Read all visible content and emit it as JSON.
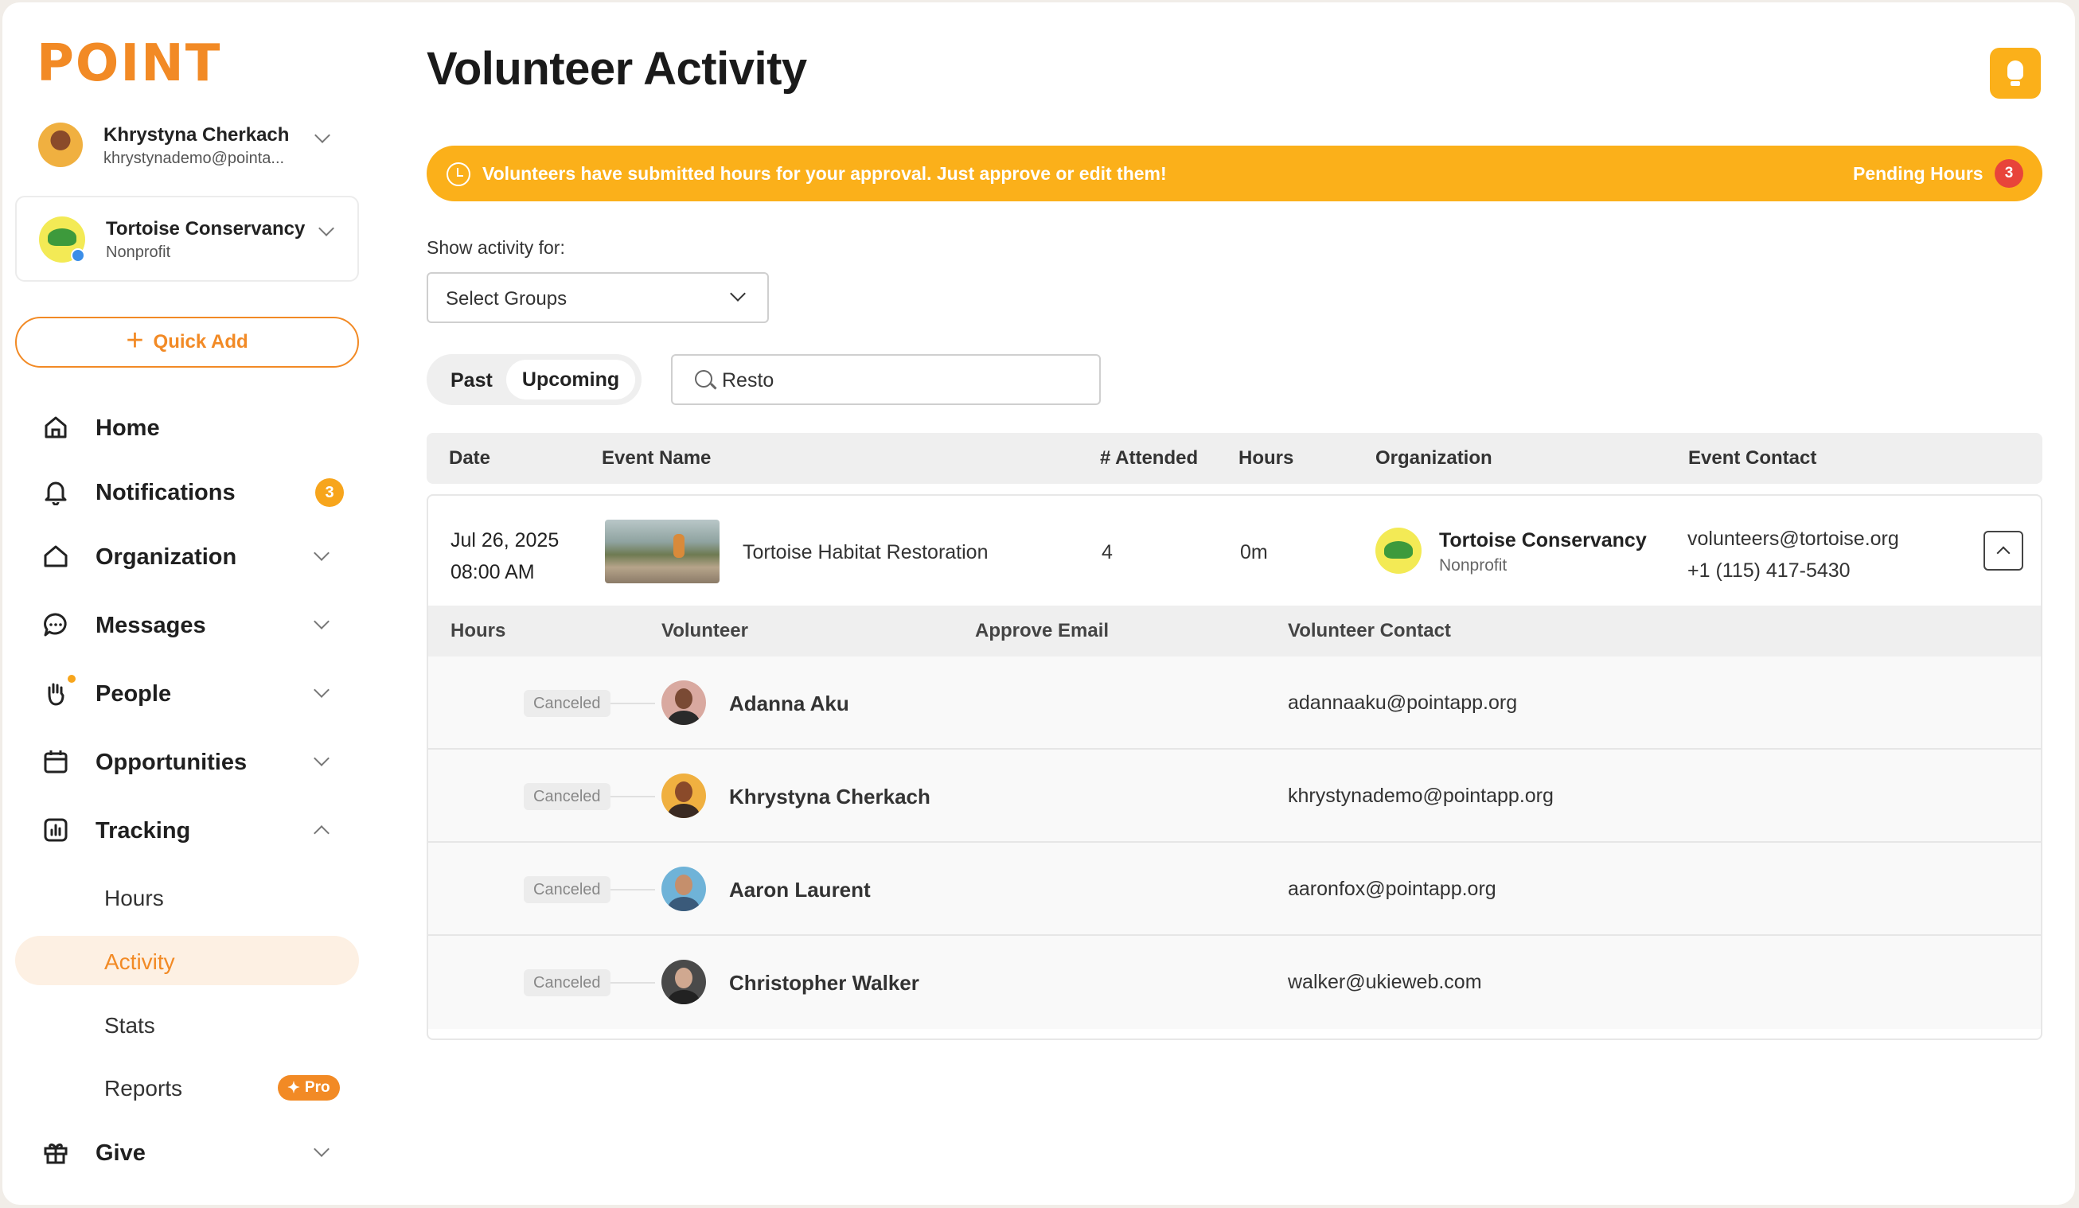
{
  "brand": {
    "logo_text": "POINT"
  },
  "user": {
    "name": "Khrystyna Cherkach",
    "email": "khrystynademo@pointa..."
  },
  "org": {
    "name": "Tortoise Conservancy",
    "type": "Nonprofit"
  },
  "sidebar": {
    "quick_add_label": "Quick Add",
    "items": [
      {
        "label": "Home",
        "icon": "home-icon"
      },
      {
        "label": "Notifications",
        "icon": "bell-icon",
        "badge": "3"
      },
      {
        "label": "Organization",
        "icon": "organization-icon"
      },
      {
        "label": "Messages",
        "icon": "message-icon"
      },
      {
        "label": "People",
        "icon": "hand-icon"
      },
      {
        "label": "Opportunities",
        "icon": "calendar-icon"
      },
      {
        "label": "Tracking",
        "icon": "chart-icon"
      },
      {
        "label": "Give",
        "icon": "gift-icon"
      }
    ],
    "tracking_sub": [
      {
        "label": "Hours"
      },
      {
        "label": "Activity",
        "active": true
      },
      {
        "label": "Stats"
      },
      {
        "label": "Reports",
        "badge": "Pro"
      }
    ]
  },
  "page": {
    "title": "Volunteer Activity",
    "banner_message": "Volunteers have submitted hours for your approval. Just approve or edit them!",
    "pending_label": "Pending Hours",
    "pending_count": "3",
    "show_activity_label": "Show activity for:",
    "select_groups_label": "Select Groups",
    "toggle": {
      "past": "Past",
      "upcoming": "Upcoming"
    },
    "search_value": "Resto"
  },
  "table": {
    "columns": [
      "Date",
      "Event Name",
      "# Attended",
      "Hours",
      "Organization",
      "Event Contact"
    ],
    "event": {
      "date": "Jul 26, 2025",
      "time": "08:00 AM",
      "name": "Tortoise Habitat Restoration",
      "attended": "4",
      "hours": "0m",
      "org_name": "Tortoise Conservancy",
      "org_type": "Nonprofit",
      "contact_email": "volunteers@tortoise.org",
      "contact_phone": "+1 (115) 417-5430"
    },
    "sub_columns": [
      "Hours",
      "Volunteer",
      "Approve Email",
      "Volunteer Contact"
    ],
    "volunteers": [
      {
        "status": "Canceled",
        "name": "Adanna Aku",
        "email": "adannaaku@pointapp.org"
      },
      {
        "status": "Canceled",
        "name": "Khrystyna Cherkach",
        "email": "khrystynademo@pointapp.org"
      },
      {
        "status": "Canceled",
        "name": "Aaron Laurent",
        "email": "aaronfox@pointapp.org"
      },
      {
        "status": "Canceled",
        "name": "Christopher Walker",
        "email": "walker@ukieweb.com"
      }
    ]
  },
  "colors": {
    "accent": "#f28a25",
    "banner": "#fbb01a",
    "alert": "#e8443a"
  }
}
